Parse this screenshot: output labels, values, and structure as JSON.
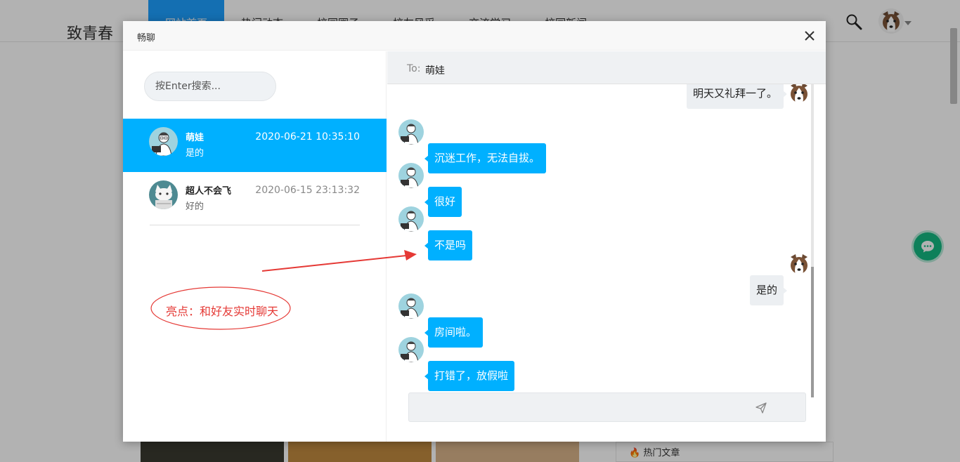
{
  "background": {
    "brand": "致青春",
    "nav": [
      "网站首页",
      "热门动态",
      "校园圈子",
      "校友风采",
      "交流学习",
      "校园新闻"
    ],
    "active_nav": 0,
    "sidecard_title": "热门文章"
  },
  "dialog": {
    "title": "畅聊",
    "search_placeholder": "按Enter搜索...",
    "conversations": [
      {
        "name": "萌娃",
        "preview": "是的",
        "time": "2020-06-21 10:35:10",
        "active": true
      },
      {
        "name": "超人不会飞",
        "preview": "好的",
        "time": "2020-06-15 23:13:32",
        "active": false
      }
    ],
    "chat": {
      "to_label": "To:",
      "to_name": "萌娃",
      "messages": [
        {
          "from": "me",
          "text": "明天又礼拜一了。"
        },
        {
          "from": "them",
          "text": "沉迷工作，无法自拔。"
        },
        {
          "from": "them",
          "text": "很好"
        },
        {
          "from": "them",
          "text": "不是吗"
        },
        {
          "from": "me",
          "text": "是的"
        },
        {
          "from": "them",
          "text": "房间啦。"
        },
        {
          "from": "them",
          "text": "打错了，放假啦"
        }
      ]
    }
  },
  "annotation": {
    "text": "亮点：和好友实时聊天",
    "color": "#e53935"
  },
  "colors": {
    "accent": "#00b0ff",
    "nav_active": "#1e9fff",
    "chat_fab": "#15b881"
  }
}
